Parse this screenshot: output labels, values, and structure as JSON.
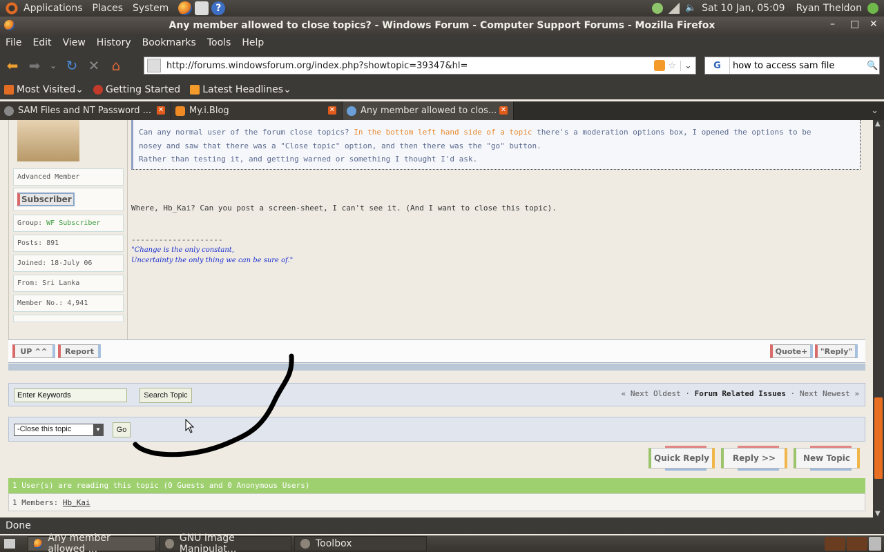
{
  "panel": {
    "menus": [
      "Applications",
      "Places",
      "System"
    ],
    "datetime": "Sat 10 Jan, 05:09",
    "user": "Ryan Theldon"
  },
  "window": {
    "title": "Any member allowed to close topics? - Windows Forum - Computer Support Forums - Mozilla Firefox"
  },
  "menubar": [
    "File",
    "Edit",
    "View",
    "History",
    "Bookmarks",
    "Tools",
    "Help"
  ],
  "navbar": {
    "url": "http://forums.windowsforum.org/index.php?showtopic=39347&hl=",
    "search_engine": "G",
    "search_query": "how to access sam file"
  },
  "bookmarks": [
    "Most Visited",
    "Getting Started",
    "Latest Headlines"
  ],
  "tabs": [
    {
      "label": "SAM Files and NT Password ..."
    },
    {
      "label": "My.i.Blog"
    },
    {
      "label": "Any member allowed to clos..."
    }
  ],
  "profile": {
    "title": "Advanced Member",
    "badge": "Subscriber",
    "group_label": "Group:",
    "group_value": "WF Subscriber",
    "posts": "Posts: 891",
    "joined": "Joined: 18-July 06",
    "from": "From: Sri Lanka",
    "member_no": "Member No.: 4,941"
  },
  "quote": {
    "line1_a": "Can any normal user of the forum close topics? ",
    "line1_highlight": "In the bottom left hand side of a topic",
    "line1_b": " there's a moderation options box, I opened the options to be",
    "line2": "nosey and saw that there was a \"Close topic\" option, and then there was the \"go\" button.",
    "line3": "Rather than testing it, and getting warned or something I thought I'd ask."
  },
  "post": {
    "reply_text": "Where, Hb_Kai? Can you post a screen-sheet, I can't see it. (And I want to close this topic).",
    "sig_divider": "--------------------",
    "sig_line1": "\"Change is the only constant,",
    "sig_line2": "Uncertainty the only thing we can be sure of.\""
  },
  "post_buttons": {
    "up": "UP ^^",
    "report": "Report",
    "quote": "Quote+",
    "reply": "\"Reply\""
  },
  "search": {
    "placeholder": "Enter Keywords",
    "button": "Search Topic"
  },
  "topic_nav": {
    "prev": "« Next Oldest",
    "sep": "·",
    "forum": "Forum Related Issues",
    "next": "Next Newest »"
  },
  "moderation": {
    "selected": "-Close this topic",
    "go": "Go"
  },
  "action_buttons": [
    "Quick Reply",
    "Reply >>",
    "New Topic"
  ],
  "readers": {
    "summary": "1 User(s) are reading this topic (0 Guests and 0 Anonymous Users)",
    "members_label": "1 Members:",
    "member": "Hb_Kai"
  },
  "status": "Done",
  "taskbar": [
    {
      "label": "Any member allowed ..."
    },
    {
      "label": "GNU Image Manipulat..."
    },
    {
      "label": "Toolbox"
    }
  ],
  "colors": {
    "firefox_orange": "#e36c24",
    "readers_green": "#9fd070",
    "quote_highlight": "#e98a30",
    "sig_blue": "#1b2fd1"
  }
}
